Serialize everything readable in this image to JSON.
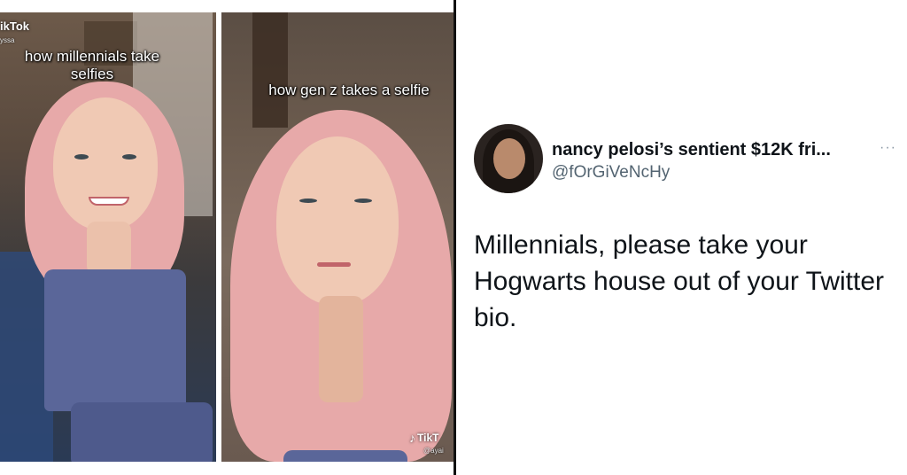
{
  "left_panel": {
    "app_label": "ikTok",
    "user_fragment": "yssa",
    "caption": "how millennials take selfies"
  },
  "right_panel": {
    "caption": "how gen z takes a selfie",
    "watermark": "TikT",
    "watermark_handle": "@ayai"
  },
  "tweet": {
    "display_name": "nancy pelosi’s sentient $12K fri...",
    "handle": "@fOrGiVeNcHy",
    "more_label": "···",
    "text": "Millennials, please take your Hogwarts house out of your Twitter bio."
  }
}
